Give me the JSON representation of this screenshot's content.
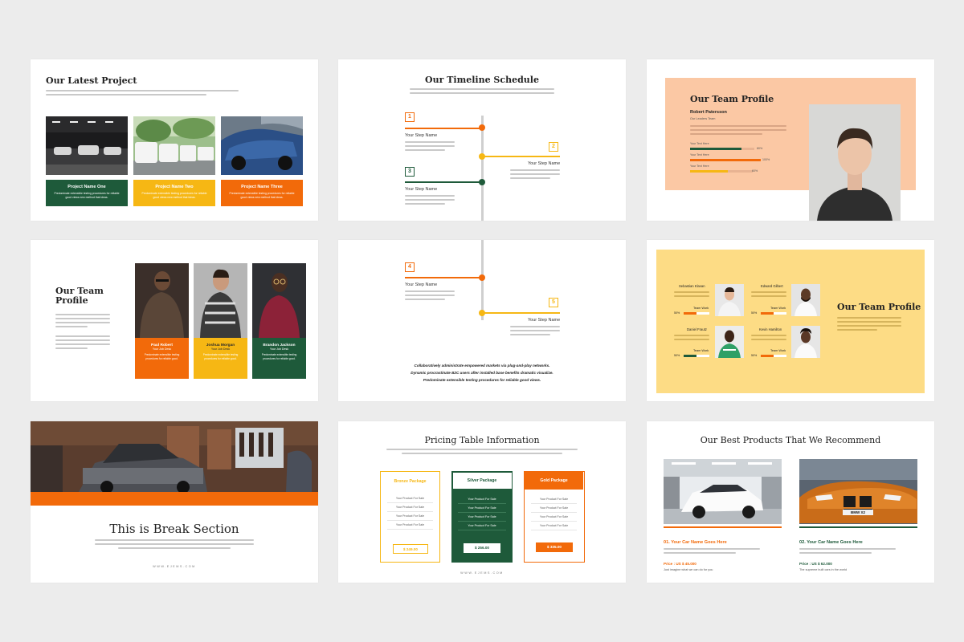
{
  "colors": {
    "green": "#1e5a3a",
    "yellow": "#f6b714",
    "orange": "#f26a0a",
    "peach": "#fbc8a4",
    "sand": "#fddc85"
  },
  "latest_project": {
    "title": "Our Latest Project",
    "cards": [
      {
        "name": "Project Name One",
        "text": "Predominate extensible testing procedures for reliable good views new method that ideas."
      },
      {
        "name": "Project Name Two",
        "text": "Predominate extensible testing procedures for reliable good views new method that ideas."
      },
      {
        "name": "Project Name Three",
        "text": "Predominate extensible testing procedures for reliable good views new method that ideas."
      }
    ]
  },
  "timeline": {
    "title": "Our Timeline Schedule",
    "steps": [
      {
        "num": "1",
        "name": "Your Step Name"
      },
      {
        "num": "2",
        "name": "Your Step Name"
      },
      {
        "num": "3",
        "name": "Your Step Name"
      },
      {
        "num": "4",
        "name": "Your Step Name"
      },
      {
        "num": "5",
        "name": "Your Step Name"
      }
    ],
    "quote": [
      "Collaboratively administrate empowered markets via plug-and-play networks.",
      "Dynamic procrastinate B2C users after installed base benefits dramatic visualize.",
      "Predominate extensible testing procedures for reliable good views."
    ]
  },
  "team_profile_1": {
    "title": "Our Team Profile",
    "name": "Robert Patersson",
    "role": "Our Leaders Team",
    "bars": [
      {
        "label": "Your Text Here",
        "value": 80,
        "pct": "80%"
      },
      {
        "label": "Your Text Here",
        "value": 100,
        "pct": "100%"
      },
      {
        "label": "Your Text Here",
        "value": 60,
        "pct": "60%"
      }
    ]
  },
  "team_profile_2": {
    "title": "Our Team Profile",
    "members": [
      {
        "name": "Paul Robert",
        "role": "Your Job Desk",
        "text": "Predominate extensible testing procedures for reliable good."
      },
      {
        "name": "Joshua Morgan",
        "role": "Your Job Desk",
        "text": "Predominate extensible testing procedures for reliable good."
      },
      {
        "name": "Brandon Jackson",
        "role": "Your Job Desk",
        "text": "Predominate extensible testing procedures for reliable good."
      }
    ]
  },
  "team_profile_3": {
    "title": "Our Team Profile",
    "members": [
      {
        "name": "Sebastian Klavan",
        "team": "Team Work",
        "pct": "50%",
        "value": 50
      },
      {
        "name": "Edward Gilbert",
        "team": "Team Work",
        "pct": "50%",
        "value": 50
      },
      {
        "name": "Daniel Frautz",
        "team": "Team Work",
        "pct": "50%",
        "value": 50
      },
      {
        "name": "Kevin Hamilton",
        "team": "Team Work",
        "pct": "50%",
        "value": 50
      }
    ]
  },
  "break_section": {
    "title": "This is Break Section",
    "url": "WWW.EJEMS.COM"
  },
  "pricing": {
    "title": "Pricing Table Information",
    "url": "WWW.EJEMS.COM",
    "plans": [
      {
        "name": "Bronze Package",
        "items": [
          "Your Product For Sale",
          "Your Product For Sale",
          "Your Product For Sale",
          "Your Product For Sale"
        ],
        "price": "$ 249.00"
      },
      {
        "name": "Silver Package",
        "items": [
          "Your Product For Sale",
          "Your Product For Sale",
          "Your Product For Sale",
          "Your Product For Sale"
        ],
        "price": "$ 256.00"
      },
      {
        "name": "Gold Package",
        "items": [
          "Your Product For Sale",
          "Your Product For Sale",
          "Your Product For Sale",
          "Your Product For Sale"
        ],
        "price": "$ 335.00"
      }
    ]
  },
  "products": {
    "title": "Our Best Products That We Recommend",
    "items": [
      {
        "name": "01. Your Car Name Goes Here",
        "price": "Price : US $ 45.000",
        "note": "Just imagine what we can do for you"
      },
      {
        "name": "02. Your Car Name Goes Here",
        "price": "Price : US $ 62.000",
        "note": "The supreme built cars in the world"
      }
    ],
    "plate": "BMW X2"
  }
}
